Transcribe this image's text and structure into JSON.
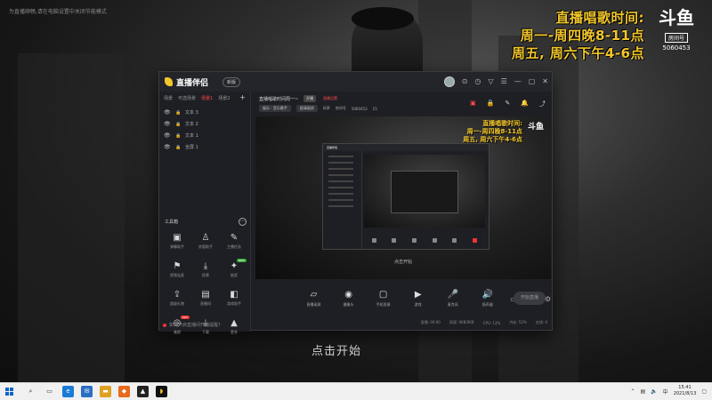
{
  "desktop": {
    "top_notice": "为直播顺畅,请在电脑设置中关闭节能模式",
    "banner": {
      "lines": [
        "直播唱歌时间:",
        "周一-周四晚8-11点",
        "周五, 周六下午4-6点"
      ],
      "logo_mark": "斗鱼",
      "logo_tag": "房间号",
      "room_number": "5060453"
    },
    "click_start": "点击开始"
  },
  "app": {
    "name": "直播伴侣",
    "version": "新版",
    "titlebar_icons": [
      "avatar",
      "gift-icon",
      "share-icon",
      "pin-icon",
      "menu-icon",
      "minimize-icon",
      "maximize-icon",
      "close-icon"
    ],
    "scene_tabs": [
      "场景",
      "可选场景",
      "场景1",
      "场景2"
    ],
    "active_scene_index": 2,
    "sources": [
      {
        "label": "文本 3"
      },
      {
        "label": "文本 2"
      },
      {
        "label": "文本 1"
      },
      {
        "label": "全屏 1"
      }
    ],
    "toolbox": {
      "title": "工具箱",
      "items": [
        {
          "label": "弹幕助手",
          "icon": "▣"
        },
        {
          "label": "房管助手",
          "icon": "♙"
        },
        {
          "label": "主播任务",
          "icon": "✎"
        },
        {
          "label": "视频连麦",
          "icon": "⚑"
        },
        {
          "label": "投票",
          "icon": "⤓"
        },
        {
          "label": "抽奖",
          "icon": "✦",
          "badge": "NEW"
        },
        {
          "label": "超级礼物",
          "icon": "⇪"
        },
        {
          "label": "直播间",
          "icon": "▤"
        },
        {
          "label": "游戏助手",
          "icon": "◧"
        },
        {
          "label": "美颜",
          "icon": "◎",
          "badge": "HOT"
        },
        {
          "label": "下载",
          "icon": "⤓"
        },
        {
          "label": "更多",
          "icon": "▲"
        }
      ]
    },
    "footer_notice": "如何开启直播间开播提醒?",
    "live": {
      "title": "直播唱歌时间周一~",
      "tag": "开播",
      "link": "直播设置",
      "category_label": "娱乐 · 音乐歌手",
      "quality": "超清画质",
      "bitrate": "码率",
      "room": "房间号",
      "room_number": "5060453",
      "fans_count": "15"
    },
    "preview": {
      "banner_lines": [
        "直播唱歌时间:",
        "周一-周四晚8-11点",
        "周五, 周六下午4-6点"
      ],
      "logo": "斗鱼",
      "start_hint": "点击开始"
    },
    "controls": [
      {
        "label": "直播录屏",
        "icon": "▱"
      },
      {
        "label": "摄像头",
        "icon": "◉"
      },
      {
        "label": "手机投屏",
        "icon": "▢"
      },
      {
        "label": "游戏",
        "icon": "▶"
      },
      {
        "label": "麦克风",
        "icon": "🎤"
      },
      {
        "label": "扬声器",
        "icon": "🔊"
      }
    ],
    "start_button": "开始直播",
    "status": [
      "直播: 00:00",
      "网速: 0KB/0KB",
      "CPU: 12%",
      "内存: 52%",
      "在线: 0"
    ]
  },
  "taskbar": {
    "time": "15:41",
    "date": "2021/8/13"
  }
}
